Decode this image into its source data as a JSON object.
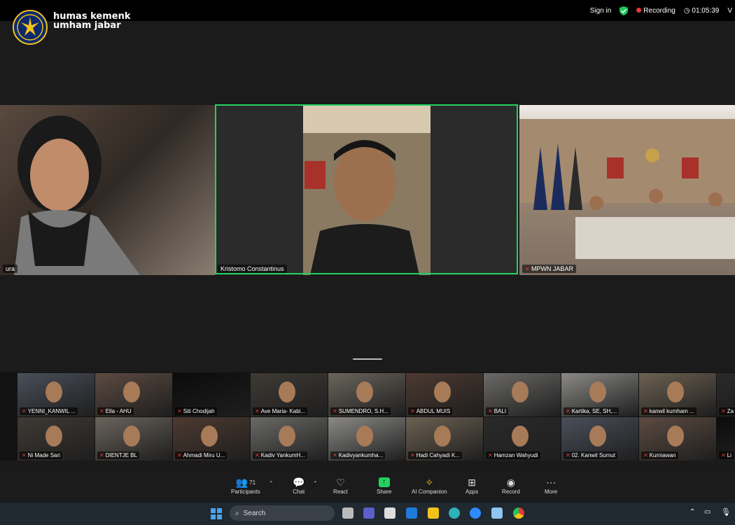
{
  "top_bar": {
    "sign_in": "Sign in",
    "recording_label": "Recording",
    "timer": "01:05:39",
    "view_label": "V"
  },
  "watermark": {
    "text": "humas kemenkumham jabar"
  },
  "main_tiles": [
    {
      "name": "ura"
    },
    {
      "name": "Kristomo Constantinus"
    },
    {
      "name": "MPWN JABAR"
    }
  ],
  "gallery": {
    "row1": [
      "YENNI_KANWIL ...",
      "Ella - AHU",
      "Siti Chodijah",
      "Ave Maria- Kabi...",
      "SUMENDRO, S.H...",
      "ABDUL MUIS",
      "BALI",
      "Kartika, SE, SH,...",
      "kanwil kumham ...",
      "Za"
    ],
    "row2": [
      "Ni Made Sari",
      "DIENTJE BL",
      "Ahmadi Miru U...",
      "Kadiv YankumH...",
      "Kadivyankumha...",
      "Hadi Cahyadi K...",
      "Hamzan Wahyudi",
      "02. Kanwil Sumut",
      "Kurniawan",
      "Li"
    ]
  },
  "toolbar": {
    "participants_count": "71",
    "participants": "Participants",
    "chat": "Chat",
    "react": "React",
    "share": "Share",
    "ai_companion": "AI Companion",
    "apps": "Apps",
    "record": "Record",
    "more": "More"
  },
  "taskbar": {
    "search_placeholder": "Search"
  },
  "colors": {
    "active_speaker_border": "#23d160",
    "share_button": "#23d160",
    "recording": "#e53935"
  }
}
